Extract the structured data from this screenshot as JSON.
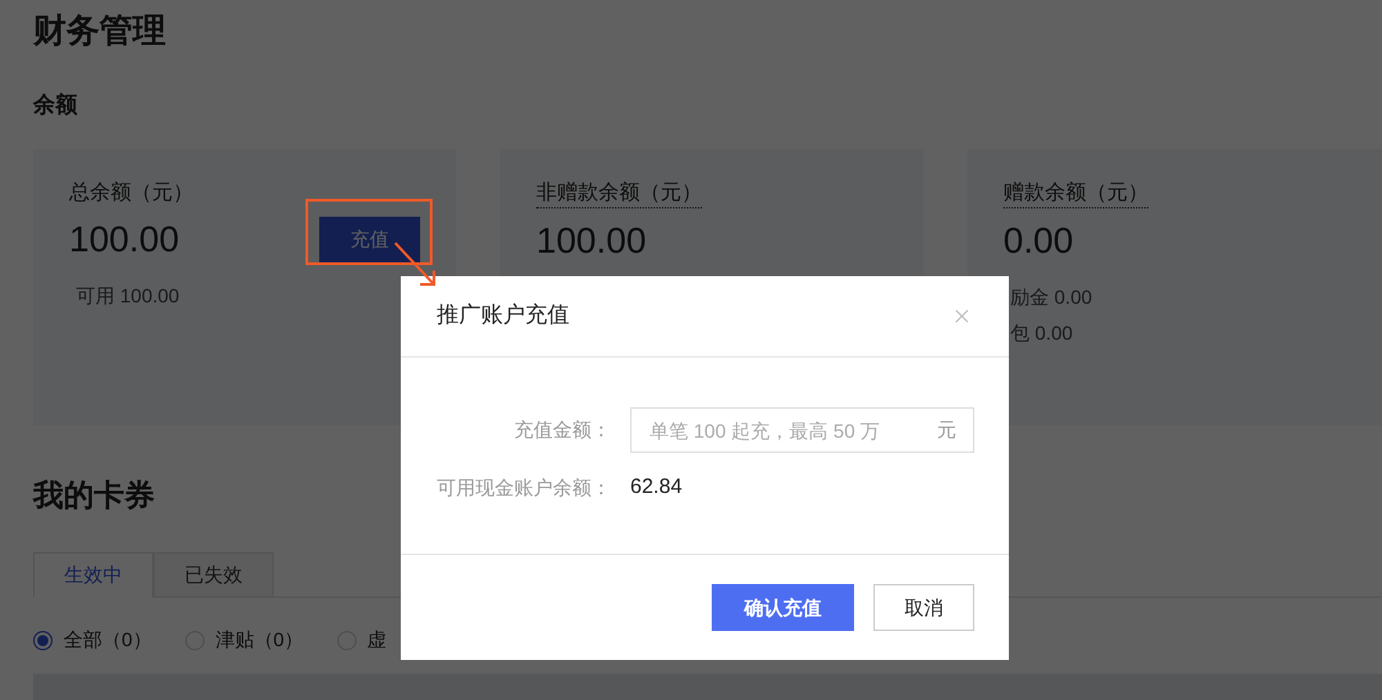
{
  "page": {
    "title": "财务管理",
    "balance_heading": "余额",
    "cards": [
      {
        "label": "总余额（元）",
        "underlined": false,
        "amount": "100.00",
        "button": "充值",
        "details": [
          "可用 100.00"
        ]
      },
      {
        "label": "非赠款余额（元）",
        "underlined": true,
        "amount": "100.00"
      },
      {
        "label": "赠款余额（元）",
        "underlined": true,
        "amount": "0.00",
        "details": [
          "励金 0.00",
          "包 0.00"
        ]
      }
    ],
    "coupons": {
      "title": "我的卡券",
      "tabs": [
        {
          "label": "生效中",
          "selected": true
        },
        {
          "label": "已失效",
          "selected": false
        }
      ],
      "filters": [
        {
          "label": "全部（0）",
          "selected": true
        },
        {
          "label": "津贴（0）",
          "selected": false
        },
        {
          "label": "虚",
          "selected": false
        }
      ]
    }
  },
  "dialog": {
    "title": "推广账户充值",
    "amount_label": "充值金额：",
    "placeholder": "单笔 100 起充，最高 50 万",
    "unit": "元",
    "balance_label": "可用现金账户余额：",
    "balance_value": "62.84",
    "buttons": [
      {
        "label": "确认充值",
        "kind": "primary"
      },
      {
        "label": "取消",
        "kind": "secondary"
      }
    ]
  }
}
